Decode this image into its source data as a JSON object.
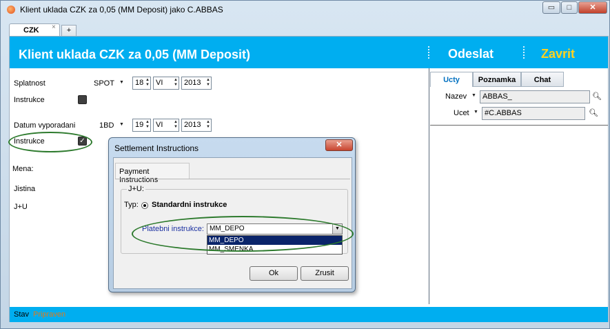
{
  "window": {
    "title": "Klient uklada CZK za 0,05 (MM Deposit) jako C.ABBAS",
    "controls": {
      "minimize": "▭",
      "maximize": "□",
      "close": "✕"
    }
  },
  "tabs": {
    "active": "CZK",
    "close_glyph": "×",
    "add": "+"
  },
  "header": {
    "title": "Klient uklada CZK za 0,05 (MM Deposit)",
    "odeslat": "Odeslat",
    "zavrit": "Zavrit"
  },
  "form": {
    "splatnost_label": "Splatnost",
    "splatnost_type": "SPOT",
    "splatnost_day": "18",
    "splatnost_month": "VI",
    "splatnost_year": "2013",
    "instrukce_label": "Instrukce",
    "datum_label": "Datum vyporadani",
    "datum_type": "1BD",
    "datum_day": "19",
    "datum_month": "VI",
    "datum_year": "2013",
    "instrukce2_label": "Instrukce",
    "mena_label": "Mena:",
    "jistina_label": "Jistina",
    "ju_label": "J+U"
  },
  "right_panel": {
    "tabs": [
      "Ucty",
      "Poznamka",
      "Chat"
    ],
    "nazev_label": "Nazev",
    "nazev_value": "ABBAS_",
    "ucet_label": "Ucet",
    "ucet_value": "#C.ABBAS"
  },
  "status": {
    "label": "Stav",
    "value": "Pripraven"
  },
  "dialog": {
    "title": "Settlement Instructions",
    "close_glyph": "✕",
    "tab": "Payment Instructions",
    "group_title": "J+U:",
    "typ_label": "Typ:",
    "typ_option": "Standardni instrukce",
    "platebni_label": "Platebni instrukce:",
    "platebni_value": "MM_DEPO",
    "options": [
      "MM_DEPO",
      "MM_SMENKA"
    ],
    "selected_option": "MM_DEPO",
    "ok_label": "Ok",
    "zrusit_label": "Zrusit"
  },
  "colors": {
    "accent": "#00aef0",
    "zavrit": "#ffd21f",
    "status_value": "#e07a1a",
    "highlight_ellipse": "#2d7a2d"
  }
}
